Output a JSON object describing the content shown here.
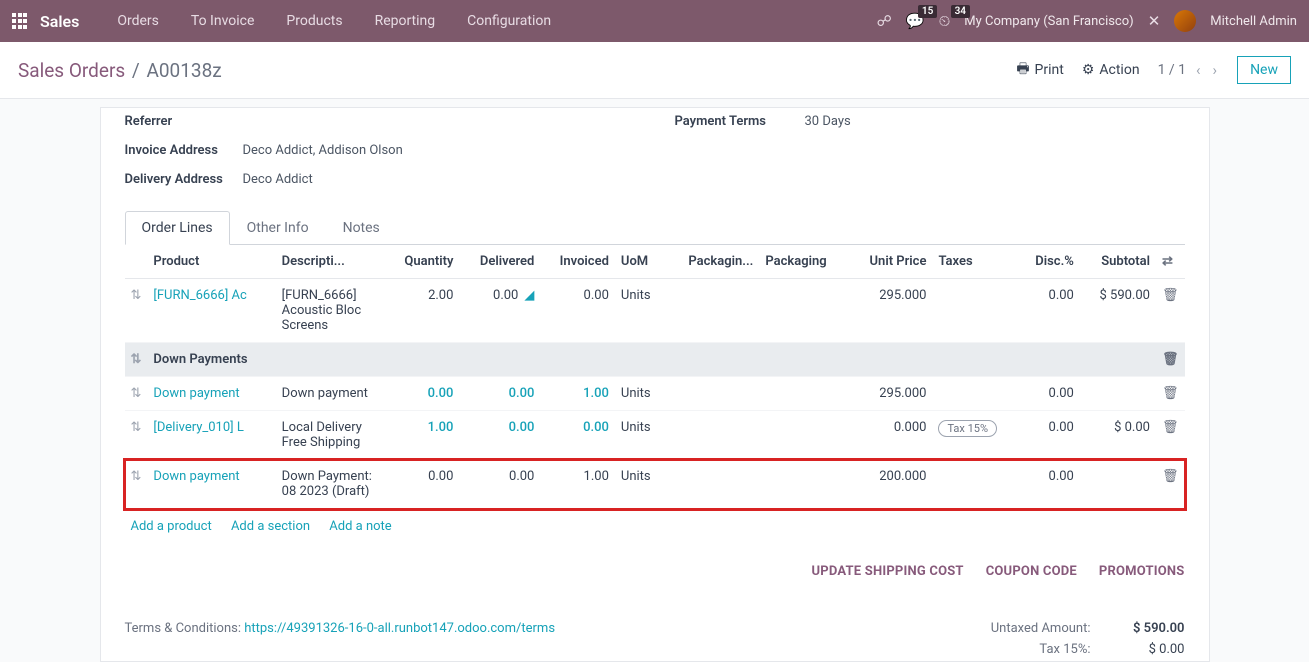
{
  "navbar": {
    "brand": "Sales",
    "menu": [
      "Orders",
      "To Invoice",
      "Products",
      "Reporting",
      "Configuration"
    ],
    "messages_badge": "15",
    "activities_badge": "34",
    "company": "My Company (San Francisco)",
    "user": "Mitchell Admin"
  },
  "breadcrumb": {
    "root": "Sales Orders",
    "leaf": "A00138z"
  },
  "controls": {
    "print": "Print",
    "action": "Action",
    "pager": "1 / 1",
    "new": "New"
  },
  "header_fields": {
    "referrer_label": "Referrer",
    "referrer_value": "",
    "invoice_address_label": "Invoice Address",
    "invoice_address_value": "Deco Addict, Addison Olson",
    "delivery_address_label": "Delivery Address",
    "delivery_address_value": "Deco Addict",
    "payment_terms_label": "Payment Terms",
    "payment_terms_value": "30 Days"
  },
  "tabs": {
    "order_lines": "Order Lines",
    "other_info": "Other Info",
    "notes": "Notes"
  },
  "columns": {
    "product": "Product",
    "description": "Descripti...",
    "quantity": "Quantity",
    "delivered": "Delivered",
    "invoiced": "Invoiced",
    "uom": "UoM",
    "packagin": "Packagin...",
    "packaging": "Packaging",
    "unit_price": "Unit Price",
    "taxes": "Taxes",
    "disc": "Disc.%",
    "subtotal": "Subtotal"
  },
  "lines": [
    {
      "type": "product",
      "product": "[FURN_6666] Ac",
      "description": "[FURN_6666] Acoustic Bloc Screens",
      "qty": "2.00",
      "delivered": "0.00",
      "delivered_chart": true,
      "invoiced": "0.00",
      "uom": "Units",
      "unit_price": "295.000",
      "taxes": "",
      "disc": "0.00",
      "subtotal": "$ 590.00",
      "link_numbers": false
    },
    {
      "type": "section",
      "label": "Down Payments"
    },
    {
      "type": "product",
      "product": "Down payment",
      "description": "Down payment",
      "qty": "0.00",
      "delivered": "0.00",
      "invoiced": "1.00",
      "uom": "Units",
      "unit_price": "295.000",
      "taxes": "",
      "disc": "0.00",
      "subtotal": "",
      "link_numbers": true
    },
    {
      "type": "product",
      "product": "[Delivery_010] L",
      "description": "Local Delivery Free Shipping",
      "qty": "1.00",
      "delivered": "0.00",
      "invoiced": "0.00",
      "uom": "Units",
      "unit_price": "0.000",
      "taxes": "Tax 15%",
      "disc": "0.00",
      "subtotal": "$ 0.00",
      "link_numbers": true
    },
    {
      "type": "product",
      "highlight": true,
      "product": "Down payment",
      "description": "Down Payment: 08 2023 (Draft)",
      "qty": "0.00",
      "delivered": "0.00",
      "invoiced": "1.00",
      "uom": "Units",
      "unit_price": "200.000",
      "taxes": "",
      "disc": "0.00",
      "subtotal": "",
      "link_numbers": false
    }
  ],
  "add_links": {
    "product": "Add a product",
    "section": "Add a section",
    "note": "Add a note"
  },
  "footer_actions": {
    "shipping": "UPDATE SHIPPING COST",
    "coupon": "COUPON CODE",
    "promo": "PROMOTIONS"
  },
  "terms": {
    "label": "Terms & Conditions: ",
    "url": "https://49391326-16-0-all.runbot147.odoo.com/terms"
  },
  "totals": {
    "untaxed_label": "Untaxed Amount:",
    "untaxed_value": "$ 590.00",
    "tax_label": "Tax 15%:",
    "tax_value": "$ 0.00"
  },
  "icons": {
    "drag": "⇅",
    "trash": "🗑",
    "print": "🖶",
    "gear": "⚙",
    "wrench": "✕",
    "chat": "💬",
    "clock": "⏲",
    "chart": "▁▃▆",
    "swap": "⇄",
    "bug": "☍"
  }
}
